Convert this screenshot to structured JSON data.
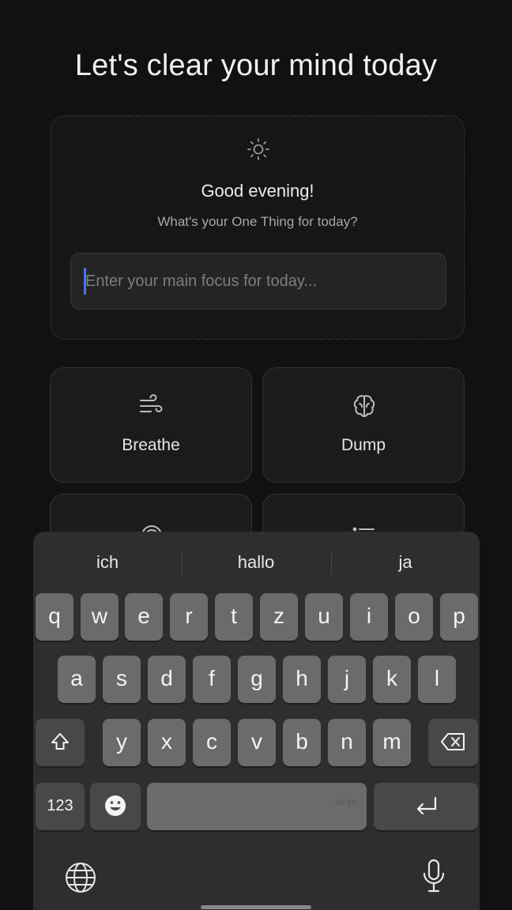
{
  "header": {
    "title": "Let's clear your mind today"
  },
  "focus_card": {
    "icon": "sun-icon",
    "greeting": "Good evening!",
    "prompt": "What's your One Thing for today?",
    "input_placeholder": "Enter your main focus for today...",
    "input_value": ""
  },
  "tiles": [
    {
      "label": "Breathe",
      "icon": "wind-icon"
    },
    {
      "label": "Dump",
      "icon": "brain-icon"
    },
    {
      "label": "",
      "icon": "fingerprint-icon"
    },
    {
      "label": "",
      "icon": "list-icon"
    }
  ],
  "keyboard": {
    "suggestions": [
      "ich",
      "hallo",
      "ja"
    ],
    "row1": [
      "q",
      "w",
      "e",
      "r",
      "t",
      "z",
      "u",
      "i",
      "o",
      "p"
    ],
    "row2": [
      "a",
      "s",
      "d",
      "f",
      "g",
      "h",
      "j",
      "k",
      "l"
    ],
    "row3": [
      "y",
      "x",
      "c",
      "v",
      "b",
      "n",
      "m"
    ],
    "numbers_label": "123",
    "space_tag": "DE EN"
  },
  "colors": {
    "background": "#111111",
    "caret": "#4c6ef5",
    "key": "#6b6b6b"
  }
}
